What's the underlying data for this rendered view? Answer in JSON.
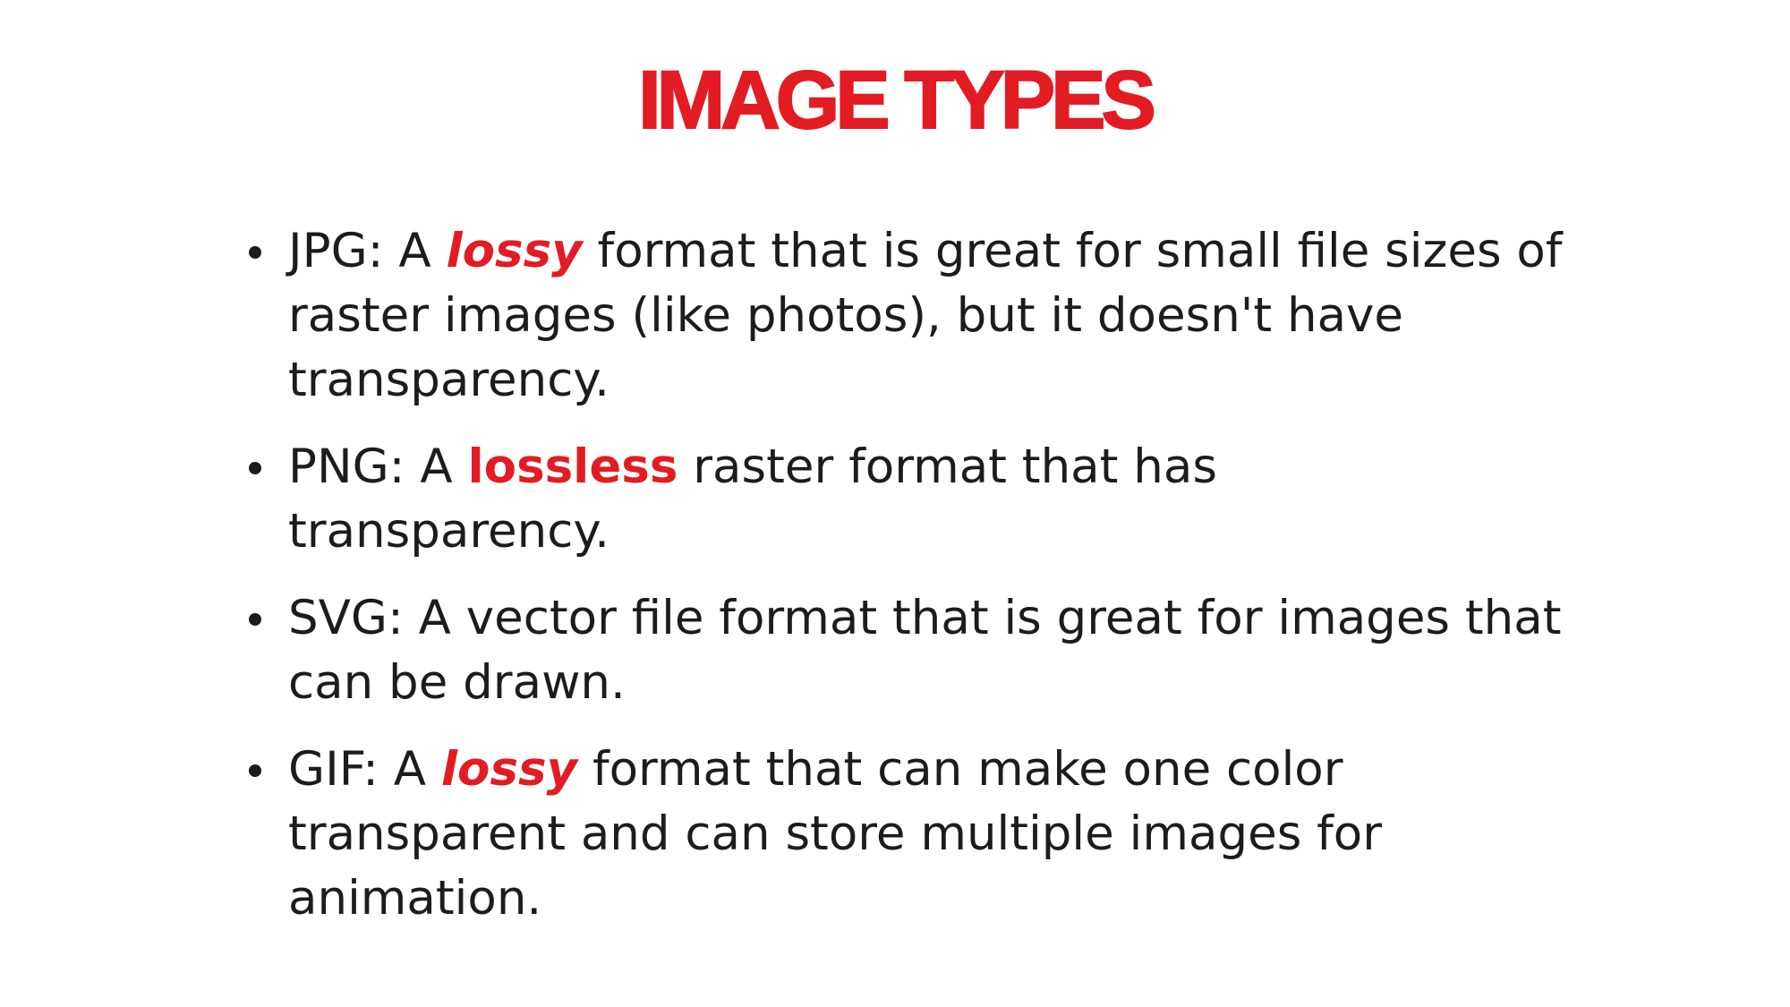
{
  "title": "IMAGE TYPES",
  "accent_color": "#e31b23",
  "text_color": "#1c1c1c",
  "bullets": [
    {
      "prefix": "JPG: A ",
      "emphasis": "lossy",
      "emphasis_style": "bold-italic",
      "suffix": " format that is great for small file sizes of raster images (like photos), but it doesn't have transparency."
    },
    {
      "prefix": "PNG: A ",
      "emphasis": "lossless",
      "emphasis_style": "bold",
      "suffix": " raster format that has transparency."
    },
    {
      "text": "SVG: A vector file format that is great for images that can be drawn."
    },
    {
      "prefix": "GIF: A ",
      "emphasis": "lossy",
      "emphasis_style": "bold-italic",
      "suffix": " format that can make one color transparent and can store multiple images for animation."
    }
  ]
}
